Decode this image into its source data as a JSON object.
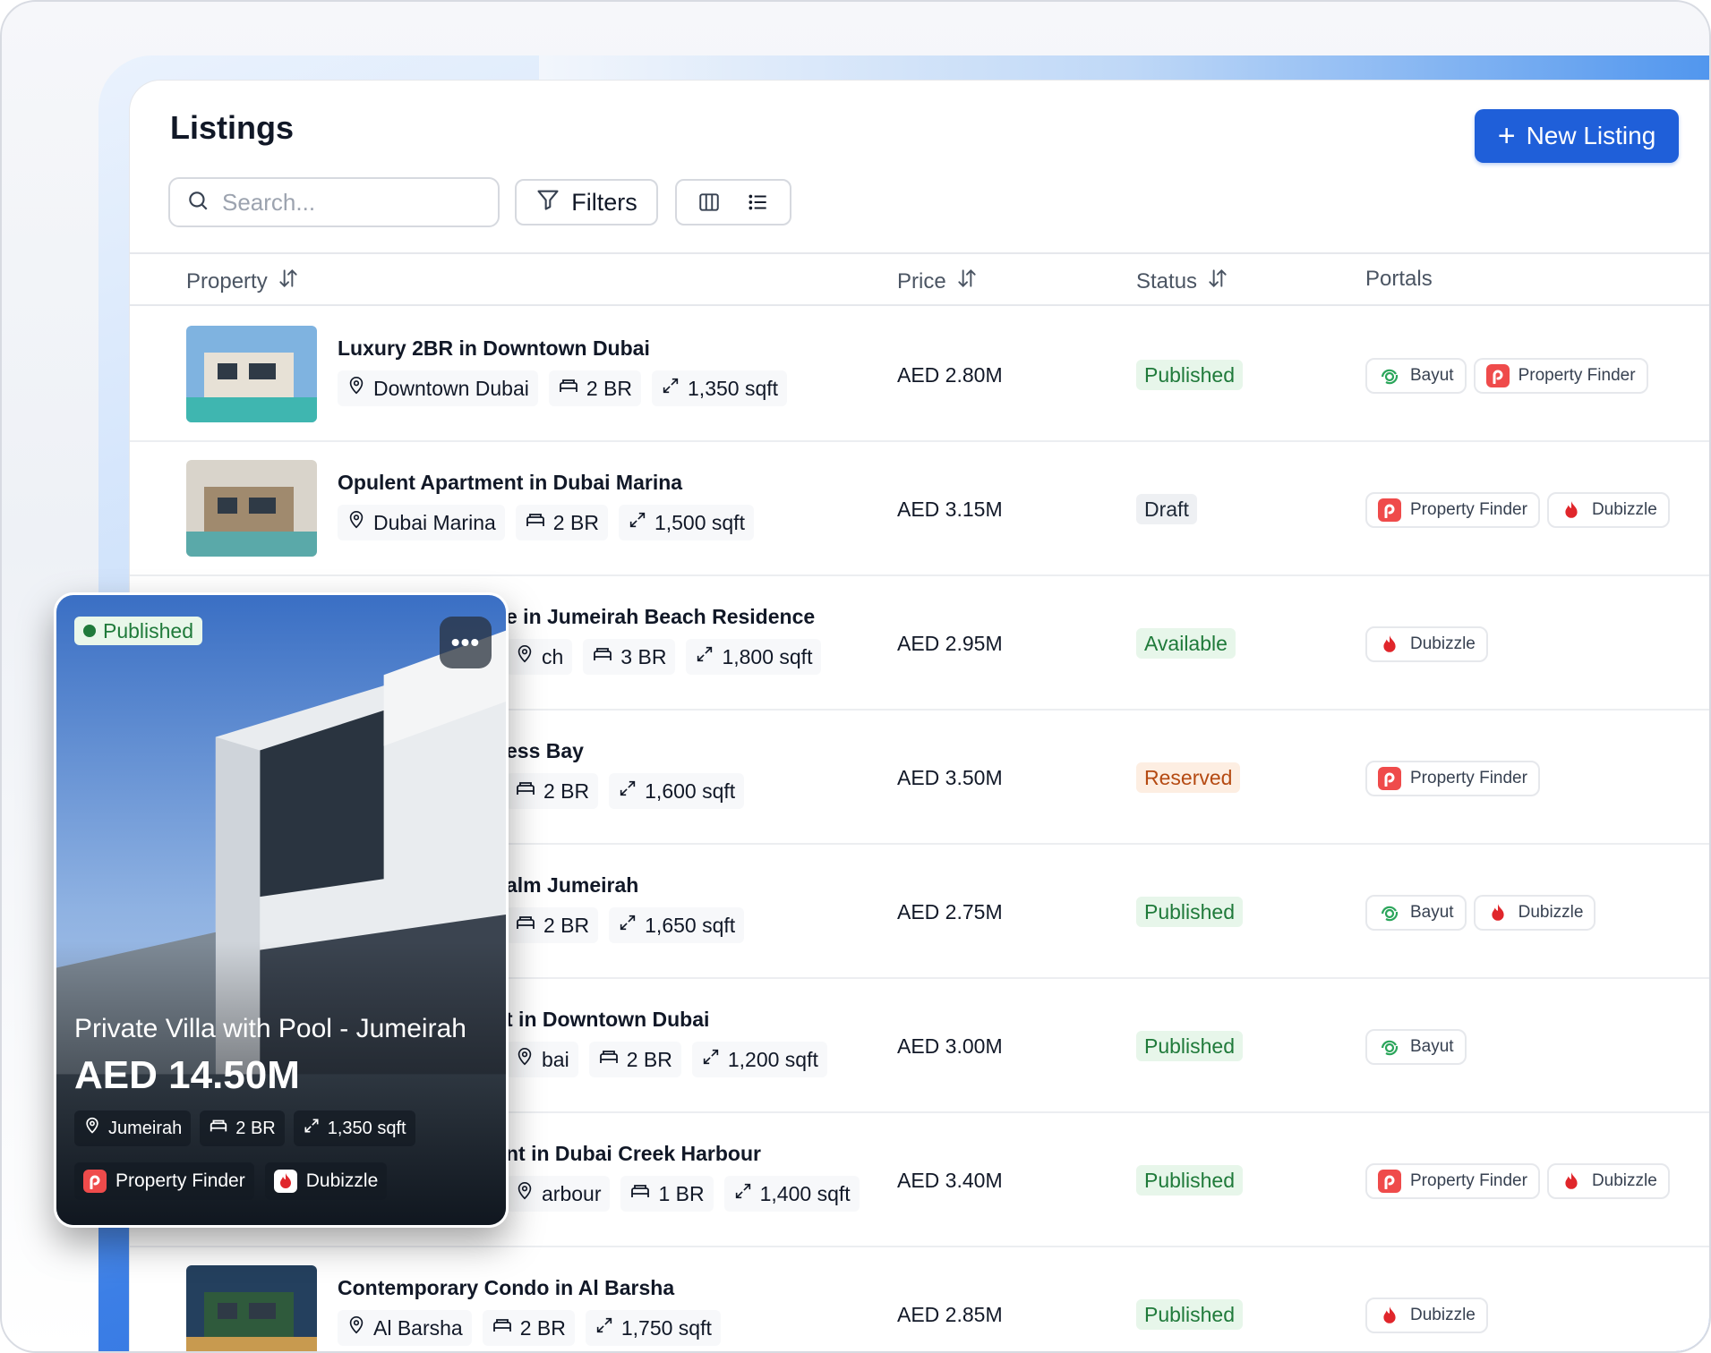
{
  "header": {
    "title": "Listings",
    "new_button_label": "New Listing"
  },
  "toolbar": {
    "search_placeholder": "Search...",
    "filters_label": "Filters"
  },
  "table": {
    "columns": {
      "property": "Property",
      "price": "Price",
      "status": "Status",
      "portals": "Portals"
    },
    "rows": [
      {
        "title": "Luxury 2BR in Downtown Dubai",
        "location": "Downtown Dubai",
        "beds": "2 BR",
        "area": "1,350 sqft",
        "price": "AED 2.80M",
        "status": "Published",
        "portals": [
          "Bayut",
          "Property Finder"
        ]
      },
      {
        "title": "Opulent Apartment in Dubai Marina",
        "location": "Dubai Marina",
        "beds": "2 BR",
        "area": "1,500 sqft",
        "price": "AED 3.15M",
        "status": "Draft",
        "portals": [
          "Property Finder",
          "Dubizzle"
        ]
      },
      {
        "title": "e in Jumeirah Beach Residence",
        "location": "ch",
        "beds": "3 BR",
        "area": "1,800 sqft",
        "price": "AED 2.95M",
        "status": "Available",
        "portals": [
          "Dubizzle"
        ]
      },
      {
        "title": "ess Bay",
        "location": "",
        "beds": "2 BR",
        "area": "1,600 sqft",
        "price": "AED 3.50M",
        "status": "Reserved",
        "portals": [
          "Property Finder"
        ]
      },
      {
        "title": "alm Jumeirah",
        "location": "",
        "beds": "2 BR",
        "area": "1,650 sqft",
        "price": "AED 2.75M",
        "status": "Published",
        "portals": [
          "Bayut",
          "Dubizzle"
        ]
      },
      {
        "title": "t in Downtown Dubai",
        "location": "bai",
        "beds": "2 BR",
        "area": "1,200 sqft",
        "price": "AED 3.00M",
        "status": "Published",
        "portals": [
          "Bayut"
        ]
      },
      {
        "title": "nt in Dubai Creek Harbour",
        "location": "arbour",
        "beds": "1 BR",
        "area": "1,400 sqft",
        "price": "AED 3.40M",
        "status": "Published",
        "portals": [
          "Property Finder",
          "Dubizzle"
        ]
      },
      {
        "title": "Contemporary Condo in Al Barsha",
        "location": "Al Barsha",
        "beds": "2 BR",
        "area": "1,750 sqft",
        "price": "AED 2.85M",
        "status": "Published",
        "portals": [
          "Dubizzle"
        ]
      }
    ]
  },
  "card": {
    "status": "Published",
    "menu": "•••",
    "title": "Private Villa with Pool - Jumeirah",
    "price": "AED 14.50M",
    "location": "Jumeirah",
    "beds": "2 BR",
    "area": "1,350 sqft",
    "portals": [
      "Property Finder",
      "Dubizzle"
    ]
  },
  "colors": {
    "accent": "#1f5fd9",
    "published": "#1f7a3a",
    "reserved": "#b54a12",
    "property_finder": "#ef4b4b",
    "dubizzle": "#e0262b",
    "bayut": "#2aa55a"
  },
  "icons": [
    "search-icon",
    "filter-icon",
    "columns-view-icon",
    "list-view-icon",
    "sort-icon",
    "location-pin-icon",
    "bed-icon",
    "area-expand-icon",
    "plus-icon",
    "more-icon"
  ]
}
